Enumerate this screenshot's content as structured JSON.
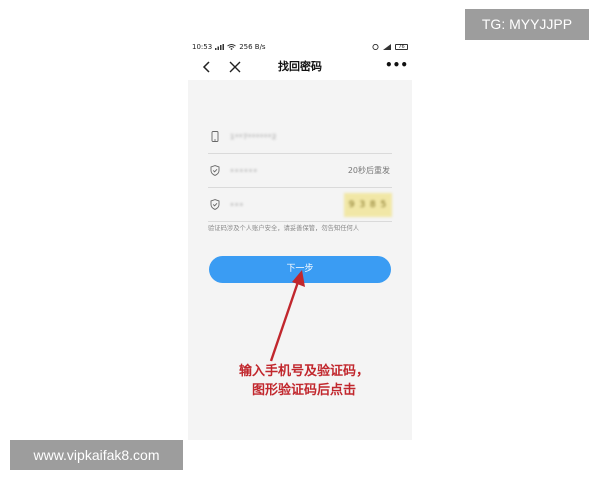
{
  "watermarks": {
    "tg": "TG: MYYJJPP",
    "url": "www.vipkaifak8.com"
  },
  "status_bar": {
    "time": "10:53",
    "speed": "256 B/s",
    "battery": "76"
  },
  "nav": {
    "back_icon": "chevron-left-icon",
    "close_icon": "close-icon",
    "title": "找回密码",
    "more": "•••"
  },
  "form": {
    "phone": {
      "icon": "phone-icon",
      "value": "1**7******2"
    },
    "sms_code": {
      "icon": "shield-icon",
      "value": "••••••",
      "resend_label": "20秒后重发"
    },
    "captcha": {
      "icon": "shield-icon",
      "value": "•••",
      "image_text": "9 3 8 5"
    },
    "notice": "验证码涉及个人账户安全，请妥善保管，勿告知任何人"
  },
  "next_button": {
    "label": "下一步"
  },
  "annotation": {
    "line1": "输入手机号及验证码，",
    "line2": "图形验证码后点击"
  },
  "colors": {
    "primary": "#3a9cf3",
    "annotation": "#c1272d",
    "background": "#f4f4f4"
  }
}
